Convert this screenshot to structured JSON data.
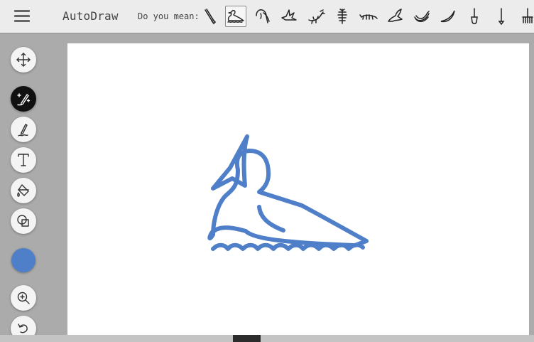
{
  "app": {
    "title": "AutoDraw"
  },
  "toolbar": {
    "menu_icon": "hamburger-icon",
    "suggestion_prompt": "Do you mean:",
    "suggestions": [
      {
        "icon": "brush-icon"
      },
      {
        "icon": "duck-icon",
        "selected": true
      },
      {
        "icon": "swan-icon"
      },
      {
        "icon": "bird-icon"
      },
      {
        "icon": "lizard-icon"
      },
      {
        "icon": "scorpion-icon"
      },
      {
        "icon": "centipede-icon"
      },
      {
        "icon": "bird-flying-icon"
      },
      {
        "icon": "banana-icon"
      },
      {
        "icon": "banana-single-icon"
      },
      {
        "icon": "shovel-icon"
      },
      {
        "icon": "stick-icon"
      },
      {
        "icon": "rake-icon"
      }
    ]
  },
  "tools": [
    {
      "name": "move",
      "icon": "move-icon"
    },
    {
      "name": "autodraw",
      "icon": "autodraw-icon",
      "active": true
    },
    {
      "name": "draw",
      "icon": "pencil-icon"
    },
    {
      "name": "type",
      "icon": "text-icon"
    },
    {
      "name": "fill",
      "icon": "fill-bucket-icon"
    },
    {
      "name": "shape",
      "icon": "shape-icon"
    },
    {
      "name": "zoom",
      "icon": "zoom-icon"
    },
    {
      "name": "undo",
      "icon": "undo-icon"
    }
  ],
  "colors": {
    "accent": "#4f7fc9",
    "active_tool_bg": "#111111",
    "toolbar_bg": "#ececec",
    "page_bg": "#ababab",
    "canvas_bg": "#ffffff"
  },
  "canvas": {
    "drawing": "duck-drawing"
  }
}
